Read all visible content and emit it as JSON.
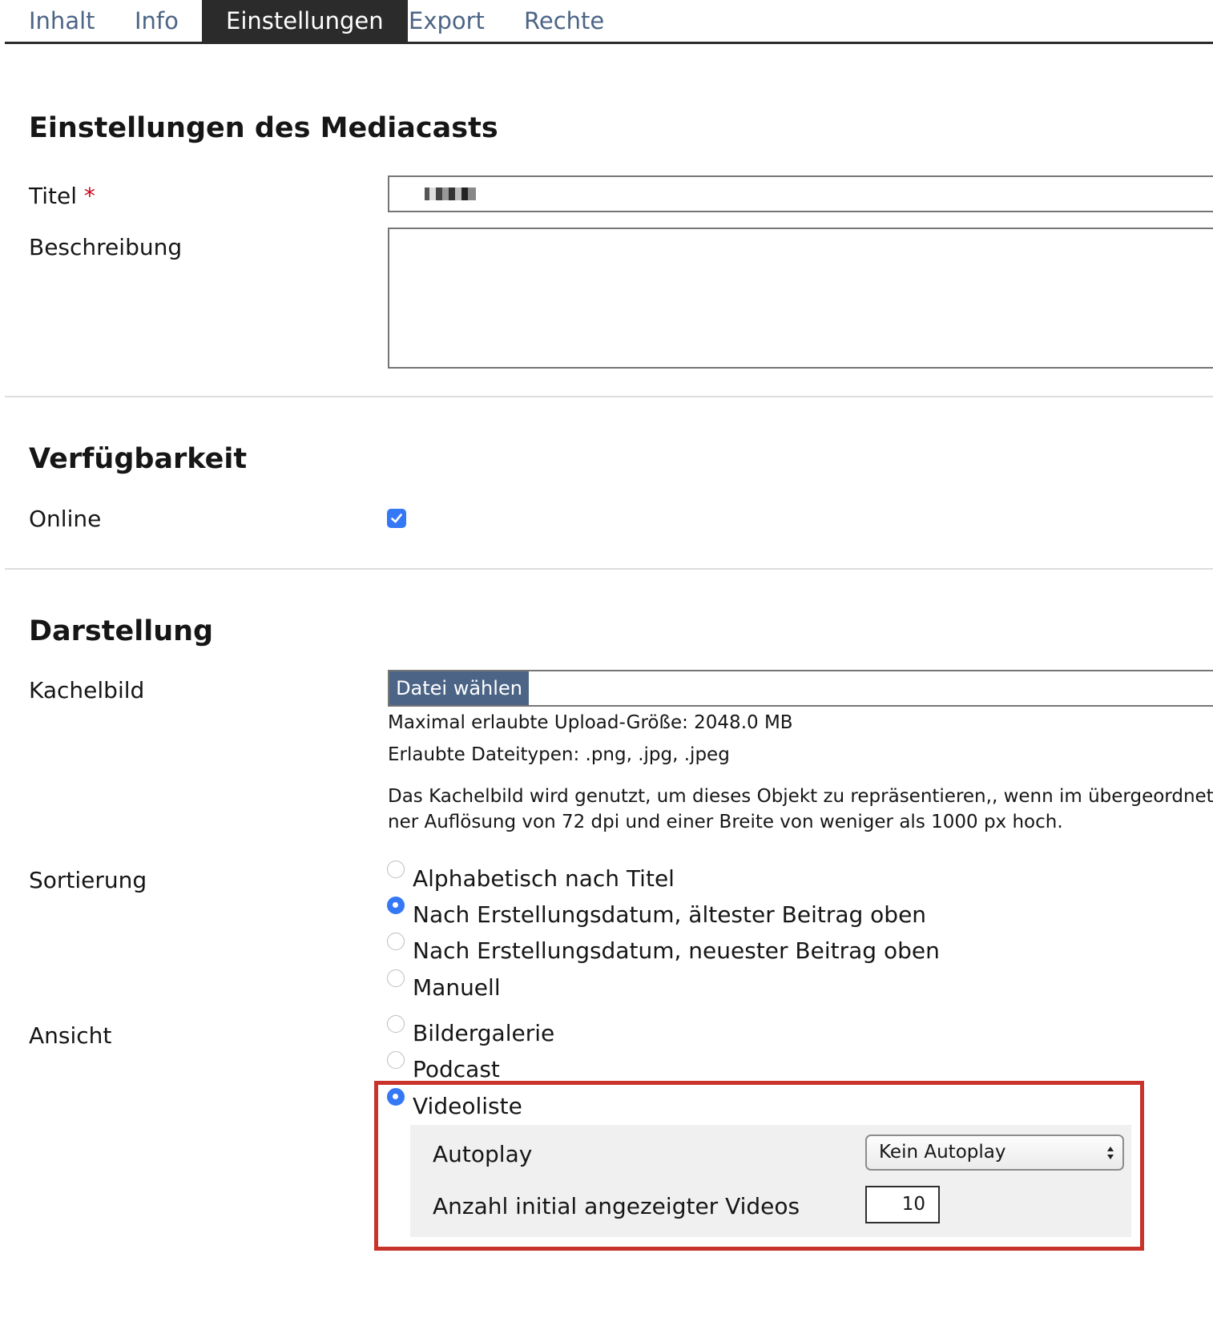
{
  "tabs": [
    {
      "label": "Inhalt",
      "active": false
    },
    {
      "label": "Info",
      "active": false
    },
    {
      "label": "Einstellungen",
      "active": true
    },
    {
      "label": "Export",
      "active": false
    },
    {
      "label": "Rechte",
      "active": false
    }
  ],
  "settings": {
    "heading": "Einstellungen des Mediacasts",
    "title_label": "Titel",
    "required_marker": "*",
    "description_label": "Beschreibung"
  },
  "availability": {
    "heading": "Verfügbarkeit",
    "online_label": "Online",
    "online_checked": true
  },
  "display": {
    "heading": "Darstellung",
    "tile_image_label": "Kachelbild",
    "file_button": "Datei wählen",
    "max_upload": "Maximal erlaubte Upload-Größe: 2048.0 MB",
    "allowed_types": "Erlaubte Dateitypen: .png, .jpg, .jpeg",
    "help_line1": "Das Kachelbild wird genutzt, um dieses Objekt zu repräsentieren,, wenn im übergeordnete",
    "help_line2": "ner Auflösung von 72 dpi und einer Breite von weniger als 1000 px hoch.",
    "sorting_label": "Sortierung",
    "sorting_options": [
      {
        "label": "Alphabetisch nach Titel",
        "checked": false
      },
      {
        "label": "Nach Erstellungsdatum, ältester Beitrag oben",
        "checked": true
      },
      {
        "label": "Nach Erstellungsdatum, neuester Beitrag oben",
        "checked": false
      },
      {
        "label": "Manuell",
        "checked": false
      }
    ],
    "view_label": "Ansicht",
    "view_options": [
      {
        "label": "Bildergalerie",
        "checked": false
      },
      {
        "label": "Podcast",
        "checked": false
      },
      {
        "label": "Videoliste",
        "checked": true
      }
    ],
    "autoplay_label": "Autoplay",
    "autoplay_value": "Kein Autoplay",
    "initial_videos_label": "Anzahl initial angezeigter Videos",
    "initial_videos_value": "10"
  },
  "colors": {
    "tab_active_bg": "#2b2b2b",
    "tab_link": "#4c6586",
    "accent_blue": "#3478f6",
    "highlight_red": "#c8342b",
    "required_red": "#d0021b"
  }
}
